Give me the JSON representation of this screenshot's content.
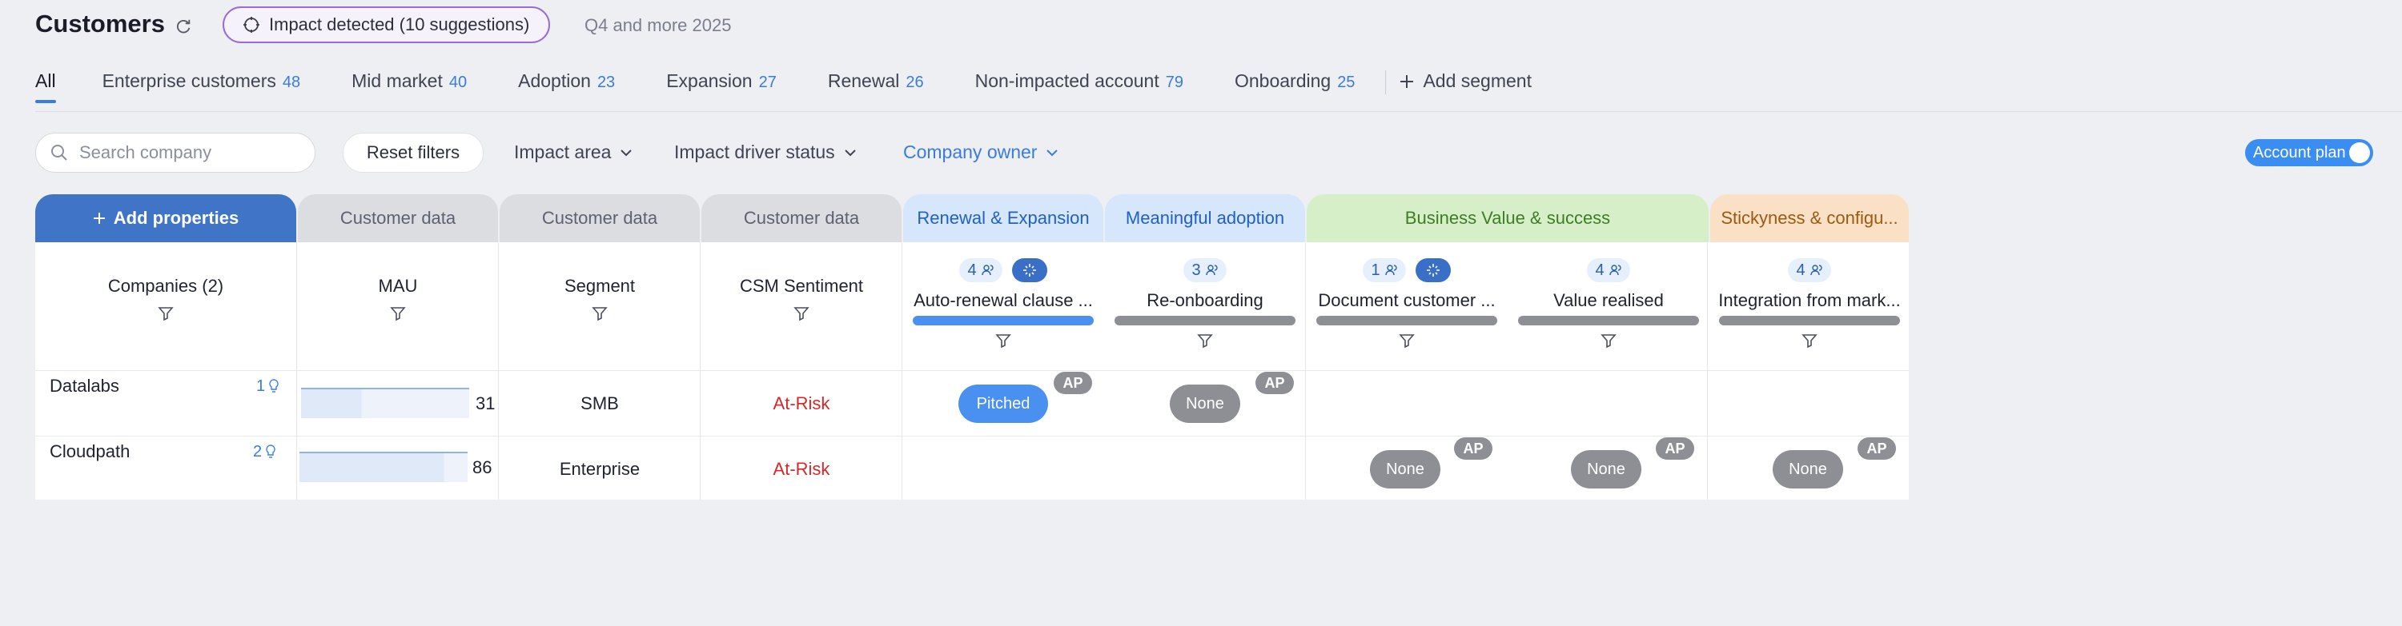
{
  "header": {
    "title": "Customers",
    "impact_label": "Impact detected (10 suggestions)",
    "quarter": "Q4 and more 2025"
  },
  "tabs": [
    {
      "label": "All",
      "count": ""
    },
    {
      "label": "Enterprise customers",
      "count": "48"
    },
    {
      "label": "Mid market",
      "count": "40"
    },
    {
      "label": "Adoption",
      "count": "23"
    },
    {
      "label": "Expansion",
      "count": "27"
    },
    {
      "label": "Renewal",
      "count": "26"
    },
    {
      "label": "Non-impacted account",
      "count": "79"
    },
    {
      "label": "Onboarding",
      "count": "25"
    }
  ],
  "add_segment": "Add segment",
  "filters": {
    "search_placeholder": "Search company",
    "reset": "Reset filters",
    "impact_area": "Impact area",
    "impact_driver_status": "Impact driver status",
    "company_owner": "Company owner",
    "account_plan": "Account plan"
  },
  "groups": {
    "add_properties": "Add properties",
    "customer_data": "Customer data",
    "renewal_expansion": "Renewal & Expansion",
    "meaningful_adoption": "Meaningful adoption",
    "business_value": "Business Value & success",
    "stickyness": "Stickyness & configu..."
  },
  "columns": {
    "companies": "Companies (2)",
    "mau": "MAU",
    "segment": "Segment",
    "csm_sentiment": "CSM Sentiment"
  },
  "signals": [
    {
      "count": "4",
      "label": "Auto-renewal clause ...",
      "has_spark": true
    },
    {
      "count": "3",
      "label": "Re-onboarding",
      "has_spark": false
    },
    {
      "count": "1",
      "label": "Document customer ...",
      "has_spark": true
    },
    {
      "count": "4",
      "label": "Value realised",
      "has_spark": false
    },
    {
      "count": "4",
      "label": "Integration from mark...",
      "has_spark": false
    }
  ],
  "rows": [
    {
      "company": "Datalabs",
      "contacts": "1",
      "mau": "31",
      "mau_level": 0.36,
      "segment": "SMB",
      "sentiment": "At-Risk",
      "renewal": "Pitched",
      "adoption": "None",
      "ap": "AP"
    },
    {
      "company": "Cloudpath",
      "contacts": "2",
      "mau": "86",
      "mau_level": 0.86,
      "segment": "Enterprise",
      "sentiment": "At-Risk",
      "doc": "None",
      "value": "None",
      "integration": "None",
      "ap": "AP"
    }
  ],
  "colors": {
    "accent": "#3a7be3",
    "at_risk": "#d62828",
    "pill_gray": "#8d8f95",
    "pill_blue": "#4a90f0"
  }
}
